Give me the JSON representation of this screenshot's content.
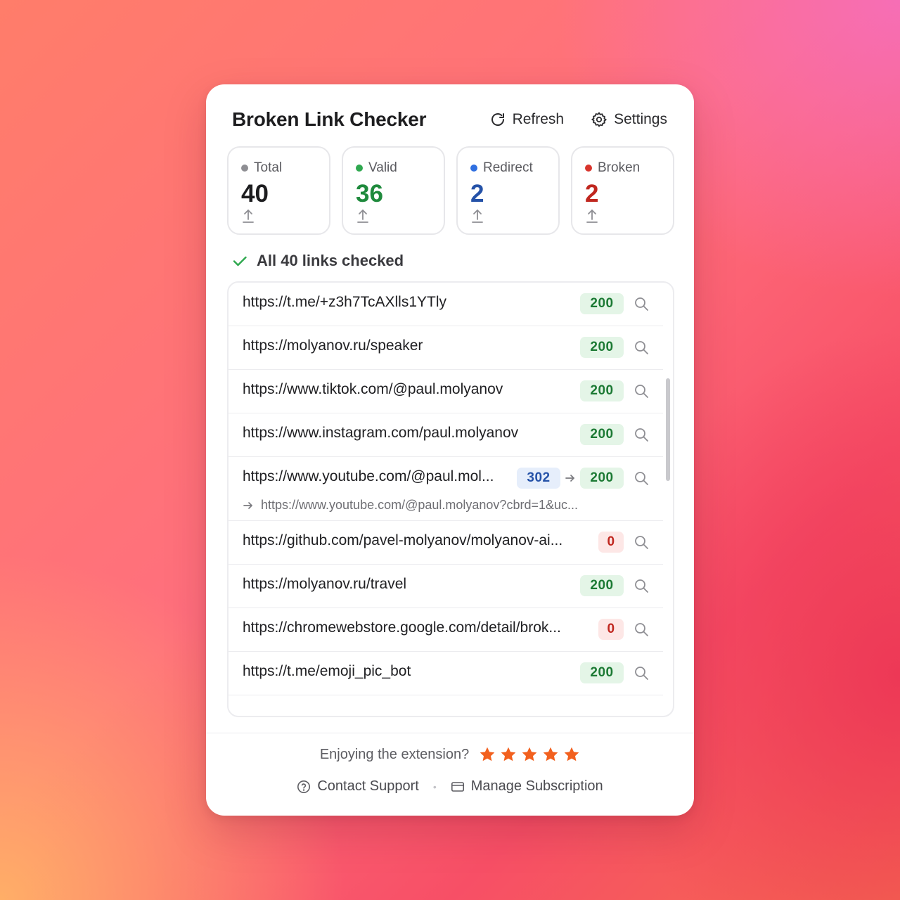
{
  "header": {
    "title": "Broken Link Checker",
    "refresh_label": "Refresh",
    "settings_label": "Settings"
  },
  "stats": [
    {
      "label": "Total",
      "value": "40",
      "dot_color": "#8e8e93",
      "value_color": "#1d1d1f"
    },
    {
      "label": "Valid",
      "value": "36",
      "dot_color": "#2fa84f",
      "value_color": "#1f8a3d"
    },
    {
      "label": "Redirect",
      "value": "2",
      "dot_color": "#2f6fe0",
      "value_color": "#2552a8"
    },
    {
      "label": "Broken",
      "value": "2",
      "dot_color": "#d8342c",
      "value_color": "#c0271f"
    }
  ],
  "status": {
    "text": "All 40 links checked"
  },
  "links": [
    {
      "url": "https://t.me/+z3h7TcAXlls1YTly",
      "code": "200"
    },
    {
      "url": "https://molyanov.ru/speaker",
      "code": "200"
    },
    {
      "url": "https://www.tiktok.com/@paul.molyanov",
      "code": "200"
    },
    {
      "url": "https://www.instagram.com/paul.molyanov",
      "code": "200"
    },
    {
      "url": "https://www.youtube.com/@paul.mol...",
      "code": "302",
      "final_code": "200",
      "redirect_url": "https://www.youtube.com/@paul.molyanov?cbrd=1&uc..."
    },
    {
      "url": "https://github.com/pavel-molyanov/molyanov-ai...",
      "code": "0"
    },
    {
      "url": "https://molyanov.ru/travel",
      "code": "200"
    },
    {
      "url": "https://chromewebstore.google.com/detail/brok...",
      "code": "0"
    },
    {
      "url": "https://t.me/emoji_pic_bot",
      "code": "200"
    }
  ],
  "footer": {
    "enjoy_text": "Enjoying the extension?",
    "star_color": "#f2601e",
    "contact_label": "Contact Support",
    "separator": "•",
    "subscription_label": "Manage Subscription"
  }
}
